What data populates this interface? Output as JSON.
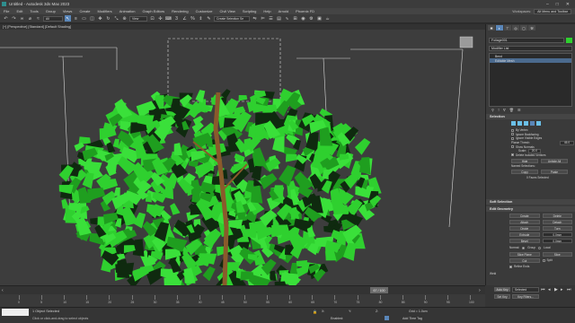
{
  "window": {
    "title": "Untitled - Autodesk 3ds Max 2023",
    "min": "–",
    "max": "□",
    "close": "✕"
  },
  "menu": {
    "items": [
      "File",
      "Edit",
      "Tools",
      "Group",
      "Views",
      "Create",
      "Modifiers",
      "Animation",
      "Graph Editors",
      "Rendering",
      "Customize",
      "Civil View",
      "Scripting",
      "Help",
      "Arnold",
      "Phoenix FD"
    ],
    "workspaces_label": "Workspaces:",
    "workspace_value": "Alt Menu and Toolbar"
  },
  "toolbar": {
    "selection_filter": "All",
    "ref_coord": "View",
    "selection_set": "Create Selection Se"
  },
  "viewport": {
    "label": "[+] [Perspective] [Standard] [Default Shading]"
  },
  "command_panel": {
    "object_name": "Foliage001",
    "modifier_list": "Modifier List",
    "stack": [
      {
        "label": "Bend"
      },
      {
        "label": "Editable Mesh"
      }
    ],
    "selection": {
      "title": "Selection",
      "checkboxes": [
        {
          "label": "By Vertex",
          "checked": false
        },
        {
          "label": "Ignore Backfacing",
          "checked": false
        },
        {
          "label": "Ignore Visible Edges",
          "checked": false
        },
        {
          "label": "Planar Thresh:",
          "checked": false
        },
        {
          "label": "Show Normals",
          "checked": false
        },
        {
          "label": "Scale:",
          "checked": false
        },
        {
          "label": "Delete Isolated Vertices",
          "checked": true
        }
      ],
      "planar_thresh_value": "45.0",
      "scale_value": "20.0",
      "hide_label": "Hide",
      "unhide_all_label": "Unhide All",
      "named_selections_label": "Named Selections:",
      "copy_label": "Copy",
      "paste_label": "Paste",
      "faces_selected": "0 Faces Selected"
    },
    "soft_selection": {
      "title": "Soft Selection"
    },
    "edit_geometry": {
      "title": "Edit Geometry",
      "buttons": [
        [
          "Create",
          "Delete"
        ],
        [
          "Attach",
          "Detach"
        ],
        [
          "Divide",
          "Turn"
        ],
        [
          "Extrude",
          "0.0mm"
        ],
        [
          "Bevel",
          "0.0mm"
        ]
      ],
      "normal_label": "Normal:",
      "group_label": "Group",
      "local_label": "Local",
      "slice_plane": "Slice Plane",
      "slice": "Slice",
      "cut": "Cut",
      "split": "Split",
      "refine_ends": "Refine Ends",
      "weld_label": "Weld"
    }
  },
  "timeline": {
    "frame_readout": "67 / 100",
    "ticks": [
      "0",
      "5",
      "10",
      "15",
      "20",
      "25",
      "30",
      "35",
      "40",
      "45",
      "50",
      "55",
      "60",
      "65",
      "70",
      "75",
      "80",
      "85",
      "90",
      "95",
      "100"
    ]
  },
  "status": {
    "selected": "1 Object Selected",
    "prompt": "Click or click-and-drag to select objects",
    "x_label": "X:",
    "y_label": "Y:",
    "z_label": "Z:",
    "grid": "Grid = 1.0cm",
    "enabled": "Enabled:",
    "add_time_tag": "Add Time Tag",
    "auto_key": "Auto Key",
    "set_key": "Set Key",
    "selected_dropdown": "Selected",
    "key_filters": "Key Filters..."
  },
  "colors": {
    "leaf": "#2fd02f",
    "leaf_dark": "#1f9e1f",
    "trunk": "#8a5a2b",
    "accent": "#5a86b8"
  }
}
